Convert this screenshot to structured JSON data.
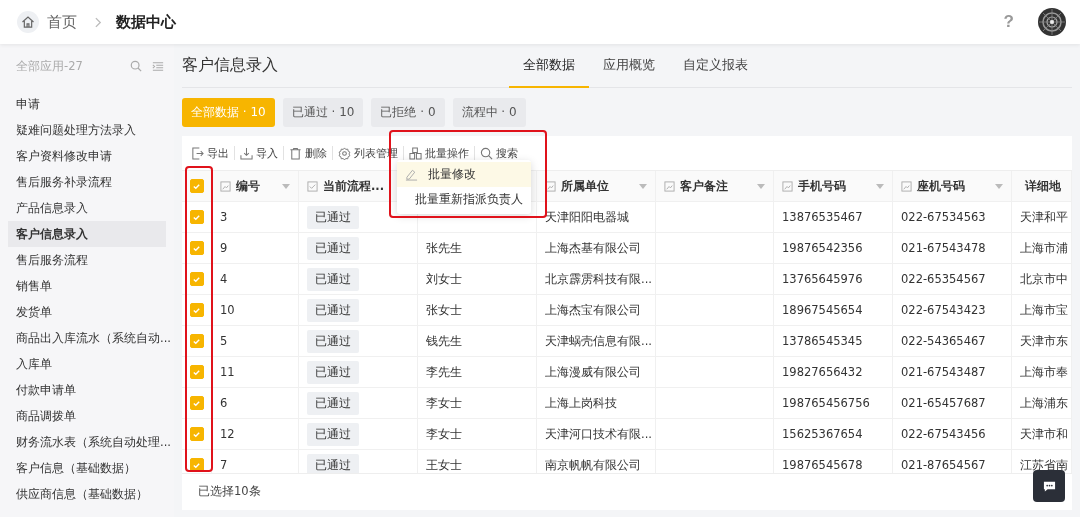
{
  "header": {
    "home": "首页",
    "current": "数据中心",
    "help": "?"
  },
  "sidebar": {
    "title": "全部应用-27",
    "items": [
      {
        "label": "申请",
        "selected": false
      },
      {
        "label": "疑难问题处理方法录入",
        "selected": false
      },
      {
        "label": "客户资料修改申请",
        "selected": false
      },
      {
        "label": "售后服务补录流程",
        "selected": false
      },
      {
        "label": "产品信息录入",
        "selected": false
      },
      {
        "label": "客户信息录入",
        "selected": true
      },
      {
        "label": "售后服务流程",
        "selected": false
      },
      {
        "label": "销售单",
        "selected": false
      },
      {
        "label": "发货单",
        "selected": false
      },
      {
        "label": "商品出入库流水（系统自动...",
        "selected": false
      },
      {
        "label": "入库单",
        "selected": false
      },
      {
        "label": "付款申请单",
        "selected": false
      },
      {
        "label": "商品调拨单",
        "selected": false
      },
      {
        "label": "财务流水表（系统自动处理...",
        "selected": false
      },
      {
        "label": "客户信息（基础数据）",
        "selected": false
      },
      {
        "label": "供应商信息（基础数据）",
        "selected": false
      }
    ]
  },
  "page": {
    "title": "客户信息录入",
    "tabs": [
      {
        "label": "全部数据",
        "selected": true
      },
      {
        "label": "应用概览",
        "selected": false
      },
      {
        "label": "自定义报表",
        "selected": false
      }
    ],
    "filters": [
      {
        "label": "全部数据 · 10",
        "selected": true
      },
      {
        "label": "已通过 · 10",
        "selected": false
      },
      {
        "label": "已拒绝 · 0",
        "selected": false
      },
      {
        "label": "流程中 · 0",
        "selected": false
      }
    ]
  },
  "toolbar": [
    {
      "label": "导出",
      "kind": "export"
    },
    {
      "label": "导入",
      "kind": "import"
    },
    {
      "label": "删除",
      "kind": "delete"
    },
    {
      "label": "列表管理",
      "kind": "settings"
    },
    {
      "label": "批量操作",
      "kind": "batch"
    },
    {
      "label": "搜索",
      "kind": "search"
    }
  ],
  "batch_menu": [
    {
      "label": "批量修改",
      "kind": "edit",
      "selected": true
    },
    {
      "label": "批量重新指派负责人",
      "kind": "person",
      "selected": false
    }
  ],
  "table": {
    "select_all": true,
    "columns": [
      {
        "label": "编号",
        "kind": "text"
      },
      {
        "label": "当前流程...",
        "kind": "check"
      },
      {
        "kind": "text"
      },
      {
        "label": "所属单位",
        "kind": "text"
      },
      {
        "label": "客户备注",
        "kind": "text"
      },
      {
        "label": "手机号码",
        "kind": "text"
      },
      {
        "label": "座机号码",
        "kind": "text"
      },
      {
        "label": "详细地",
        "kind": "text"
      }
    ],
    "rows": [
      {
        "checked": true,
        "cells": [
          "3",
          "已通过",
          null,
          "天津阳阳电器城",
          null,
          "13876535467",
          "022-67534563",
          "天津和平"
        ]
      },
      {
        "checked": true,
        "cells": [
          "9",
          "已通过",
          "张先生",
          "上海杰基有限公司",
          null,
          "19876542356",
          "021-67543478",
          "上海市浦"
        ]
      },
      {
        "checked": true,
        "cells": [
          "4",
          "已通过",
          "刘女士",
          "北京霹雳科技有限...",
          null,
          "13765645976",
          "022-65354567",
          "北京市中"
        ]
      },
      {
        "checked": true,
        "cells": [
          "10",
          "已通过",
          "张女士",
          "上海杰宝有限公司",
          null,
          "18967545654",
          "022-67543423",
          "上海市宝"
        ]
      },
      {
        "checked": true,
        "cells": [
          "5",
          "已通过",
          "钱先生",
          "天津蜗壳信息有限...",
          null,
          "13786545345",
          "022-54365467",
          "天津市东"
        ]
      },
      {
        "checked": true,
        "cells": [
          "11",
          "已通过",
          "李先生",
          "上海漫威有限公司",
          null,
          "19827656432",
          "021-67543487",
          "上海市奉"
        ]
      },
      {
        "checked": true,
        "cells": [
          "6",
          "已通过",
          "李女士",
          "上海上岗科技",
          null,
          "198765456756",
          "021-65457687",
          "上海浦东"
        ]
      },
      {
        "checked": true,
        "cells": [
          "12",
          "已通过",
          "李女士",
          "天津河口技术有限...",
          null,
          "15625367654",
          "022-67543456",
          "天津市和"
        ]
      },
      {
        "checked": true,
        "cells": [
          "7",
          "已通过",
          "王女士",
          "南京帆帆有限公司",
          null,
          "19876545678",
          "021-87654567",
          "江苏省南"
        ]
      }
    ],
    "footer": "已选择10条"
  }
}
